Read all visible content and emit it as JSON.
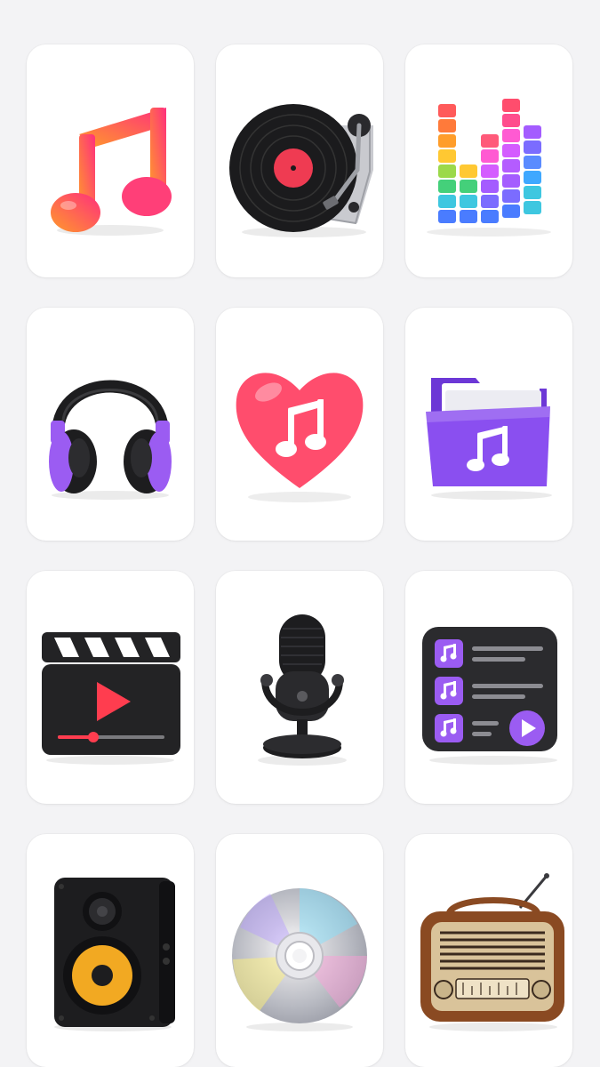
{
  "icons": [
    {
      "name": "music-note-icon",
      "colors": [
        "#ff8a2b",
        "#ff3d7a"
      ]
    },
    {
      "name": "turntable-icon",
      "colors": [
        "#1b1b1d",
        "#ef3b52",
        "#c9cacf"
      ]
    },
    {
      "name": "equalizer-bars-icon",
      "colors": [
        "#ff5a5a",
        "#ff9d2a",
        "#ffd23a",
        "#44d07a",
        "#3ec7e0",
        "#4a7cff",
        "#a45cff",
        "#ff5ad2"
      ]
    },
    {
      "name": "headphones-icon",
      "colors": [
        "#1d1d1f",
        "#9b5cf2"
      ]
    },
    {
      "name": "heart-music-icon",
      "colors": [
        "#ff4d6d",
        "#ffffff"
      ]
    },
    {
      "name": "music-folder-icon",
      "colors": [
        "#8a4ff0",
        "#ffffff"
      ]
    },
    {
      "name": "video-clapperboard-icon",
      "colors": [
        "#232325",
        "#ff3d4f",
        "#ffffff"
      ]
    },
    {
      "name": "microphone-icon",
      "colors": [
        "#1d1d1f",
        "#5a5a5e"
      ]
    },
    {
      "name": "playlist-icon",
      "colors": [
        "#2b2b2e",
        "#9b5cf2"
      ]
    },
    {
      "name": "speaker-icon",
      "colors": [
        "#1d1d1f",
        "#f2a922"
      ]
    },
    {
      "name": "cd-disc-icon",
      "colors": [
        "#d8d8dc",
        "#7fe3ff",
        "#ff9bd6",
        "#fff27a"
      ]
    },
    {
      "name": "retro-radio-icon",
      "colors": [
        "#8a4a22",
        "#d9c39a",
        "#3a2a1e"
      ]
    }
  ]
}
